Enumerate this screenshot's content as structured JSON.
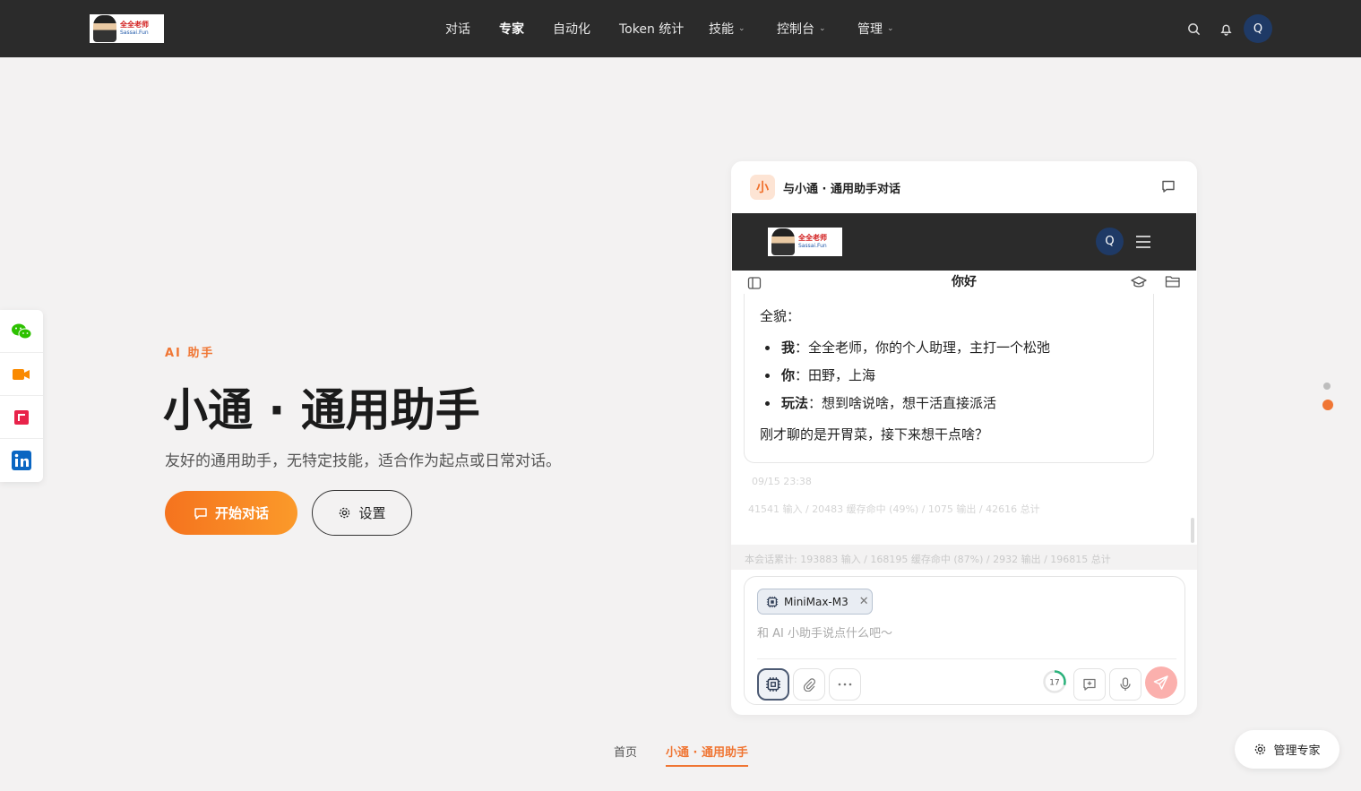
{
  "topbar": {
    "logo_text": "全全老师",
    "logo_sub": "Sassai.Fun",
    "nav": [
      {
        "label": "对话"
      },
      {
        "label": "专家"
      },
      {
        "label": "自动化"
      },
      {
        "label": "Token 统计"
      },
      {
        "label": "技能"
      },
      {
        "label": "控制台"
      },
      {
        "label": "管理"
      }
    ],
    "avatar_initial": "Q"
  },
  "hero": {
    "eyebrow": "AI 助手",
    "title": "小通 · 通用助手",
    "subtitle": "友好的通用助手，无特定技能，适合作为起点或日常对话。",
    "start_button": "开始对话",
    "settings_button": "设置"
  },
  "social": [
    "wechat-icon",
    "video-icon",
    "xiaohongshu-icon",
    "linkedin-icon"
  ],
  "chat_card": {
    "badge": "小",
    "title": "与小通 · 通用助手对话",
    "inner_avatar": "Q",
    "inner_title": "你好",
    "message": {
      "heading": "全貌：",
      "items": [
        {
          "key": "我",
          "value": "：全全老师，你的个人助理，主打一个松弛"
        },
        {
          "key": "你",
          "value": "：田野，上海"
        },
        {
          "key": "玩法",
          "value": "：想到啥说啥，想干活直接派活"
        }
      ],
      "closing": "刚才聊的是开胃菜，接下来想干点啥？"
    },
    "timestamp": "09/15 23:38",
    "turn_usage": "41541 输入 / 20483 缓存命中 (49%) / 1075 输出 / 42616 总计",
    "session_usage": "本会话累计: 193883 输入 / 168195 缓存命中 (87%) / 2932 输出 / 196815 总计",
    "composer": {
      "model": "MiniMax-M3",
      "placeholder": "和 AI 小助手说点什么吧～",
      "context_count": "17",
      "context_fraction": 0.3
    }
  },
  "breadcrumb": {
    "home": "首页",
    "current": "小通 · 通用助手"
  },
  "manage_button": "管理专家",
  "colors": {
    "accent": "#f07634",
    "topbar": "#2b2b2b",
    "avatar": "#1f3a66",
    "page_bg": "#f3f2f2"
  }
}
